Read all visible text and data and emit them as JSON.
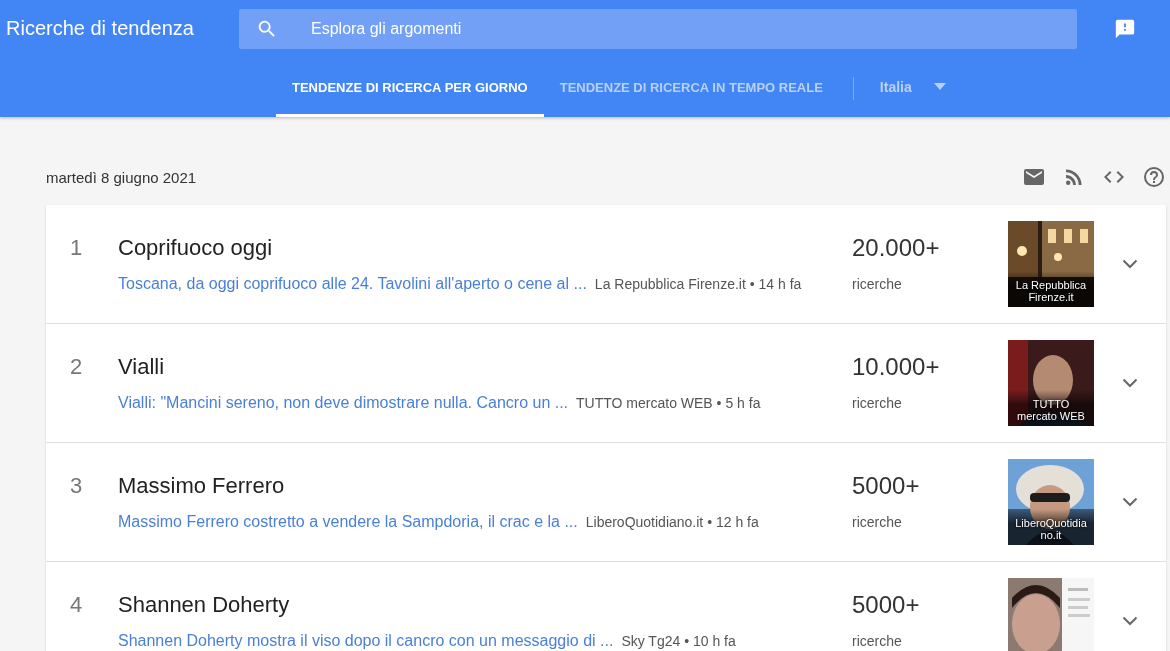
{
  "header": {
    "title": "Ricerche di tendenza",
    "search": {
      "placeholder": "Esplora gli argomenti"
    }
  },
  "tabs": [
    {
      "label": "TENDENZE DI RICERCA PER GIORNO",
      "selected": true
    },
    {
      "label": "TENDENZE DI RICERCA IN TEMPO REALE",
      "selected": false
    }
  ],
  "country": "Italia",
  "date": "martedì 8 giugno 2021",
  "trends": [
    {
      "rank": "1",
      "title": "Coprifuoco oggi",
      "article": "Toscana, da oggi coprifuoco alle 24. Tavolini all'aperto o cene al ...",
      "source": "La Repubblica Firenze.it • 14 h fa",
      "count": "20.000+",
      "count_label": "ricerche",
      "thumbnail": {
        "kind": "street",
        "caption": "La Repubblica Firenze.it"
      }
    },
    {
      "rank": "2",
      "title": "Vialli",
      "article": "Vialli: \"Mancini sereno, non deve dimostrare nulla. Cancro un ...",
      "source": "TUTTO mercato WEB • 5 h fa",
      "count": "10.000+",
      "count_label": "ricerche",
      "thumbnail": {
        "kind": "portrait",
        "caption": "TUTTO mercato WEB"
      }
    },
    {
      "rank": "3",
      "title": "Massimo Ferrero",
      "article": "Massimo Ferrero costretto a vendere la Sampdoria, il crac e la ...",
      "source": "LiberoQuotidiano.it • 12 h fa",
      "count": "5000+",
      "count_label": "ricerche",
      "thumbnail": {
        "kind": "outdoor",
        "caption": "LiberoQuotidia no.it"
      }
    },
    {
      "rank": "4",
      "title": "Shannen Doherty",
      "article": "Shannen Doherty mostra il viso dopo il cancro con un messaggio di ...",
      "source": "Sky Tg24 • 10 h fa",
      "count": "5000+",
      "count_label": "ricerche",
      "thumbnail": {
        "kind": "post"
      }
    }
  ]
}
